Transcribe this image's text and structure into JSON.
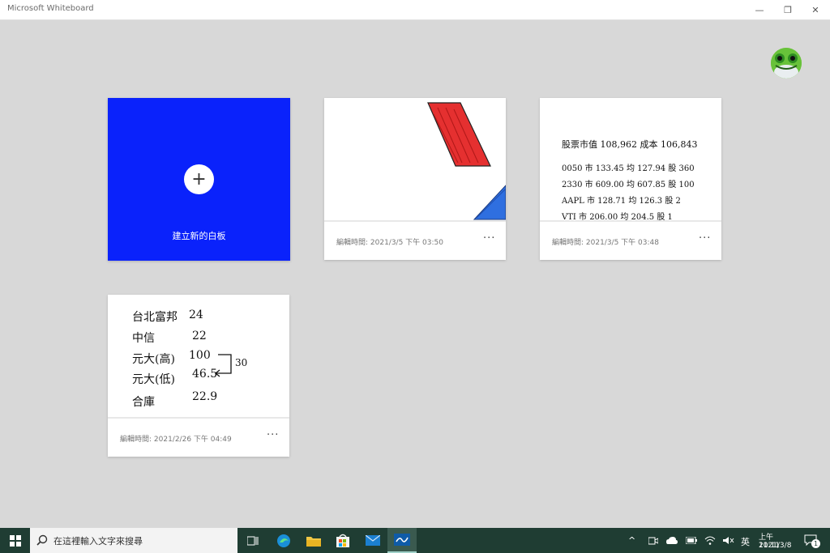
{
  "window": {
    "title": "Microsoft Whiteboard",
    "min_glyph": "—",
    "max_glyph": "❐",
    "close_glyph": "✕"
  },
  "new_board": {
    "plus": "+",
    "label": "建立新的白板"
  },
  "boards": [
    {
      "meta": "編輯時間: 2021/3/5 下午 03:50",
      "more": "···"
    },
    {
      "meta": "編輯時間: 2021/3/5 下午 03:48",
      "more": "···",
      "lines": [
        "股票市值 108,962  成本 106,843",
        "0050  市 133.45  均 127.94  股 360",
        "2330  市 609.00  均 607.85  股 100",
        "AAPL  市 128.71  均 126.3   股 2",
        "VTI   市 206.00  均 204.5   股 1"
      ]
    },
    {
      "meta": "編輯時間: 2021/2/26 下午 04:49",
      "more": "···",
      "lines": [
        {
          "name": "台北富邦",
          "value": "24"
        },
        {
          "name": "中信",
          "value": "22"
        },
        {
          "name": "元大(高)",
          "value": "100"
        },
        {
          "name": "元大(低)",
          "value": "46.5"
        },
        {
          "name": "合庫",
          "value": "22.9"
        }
      ],
      "bracket_note": "30"
    }
  ],
  "taskbar": {
    "search_placeholder": "在這裡輸入文字來搜尋",
    "ime": "英",
    "time": "上午 11:11",
    "date": "2021/3/8",
    "notification_count": "1",
    "accent": "#1f3d33"
  }
}
